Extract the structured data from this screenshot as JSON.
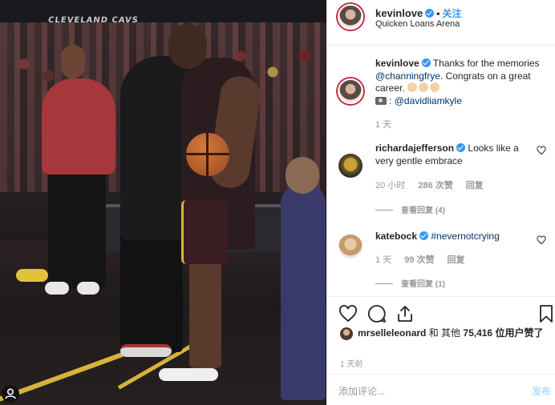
{
  "photo": {
    "banner_text": "CLEVELAND CAVS"
  },
  "post_header": {
    "username": "kevinlove",
    "separator": "•",
    "follow_label": "关注",
    "location": "Quicken Loans Arena"
  },
  "caption": {
    "username": "kevinlove",
    "text_1": "Thanks for the memories",
    "mention_1": "@channingfrye",
    "text_2": ". Congrats on a great career.",
    "credit": "@davidliamkyle",
    "credit_separator": ":",
    "time": "1 天"
  },
  "comments": [
    {
      "username": "richardajefferson",
      "text": "Looks like a very gentle embrace",
      "time": "20 小时",
      "likes": "286 次赞",
      "reply_label": "回复",
      "view_replies": "查看回复 (4)"
    },
    {
      "username": "katebock",
      "text": "#nevernotcrying",
      "time": "1 天",
      "likes": "99 次赞",
      "reply_label": "回复",
      "view_replies": "查看回复 (1)"
    }
  ],
  "likes": {
    "username": "mrselleleonard",
    "text_and": "和 其他",
    "count": "75,416",
    "text_suffix": "位用户赞了"
  },
  "post_time": "1 天前",
  "add_comment": {
    "placeholder": "添加评论...",
    "post_label": "发布"
  },
  "colors": {
    "link": "#003569",
    "accent": "#3897f0",
    "post_disabled": "#b2dffc"
  },
  "icons": [
    "heart-icon",
    "comment-icon",
    "share-icon",
    "bookmark-icon",
    "verified-icon",
    "tag-icon",
    "more-icon"
  ]
}
